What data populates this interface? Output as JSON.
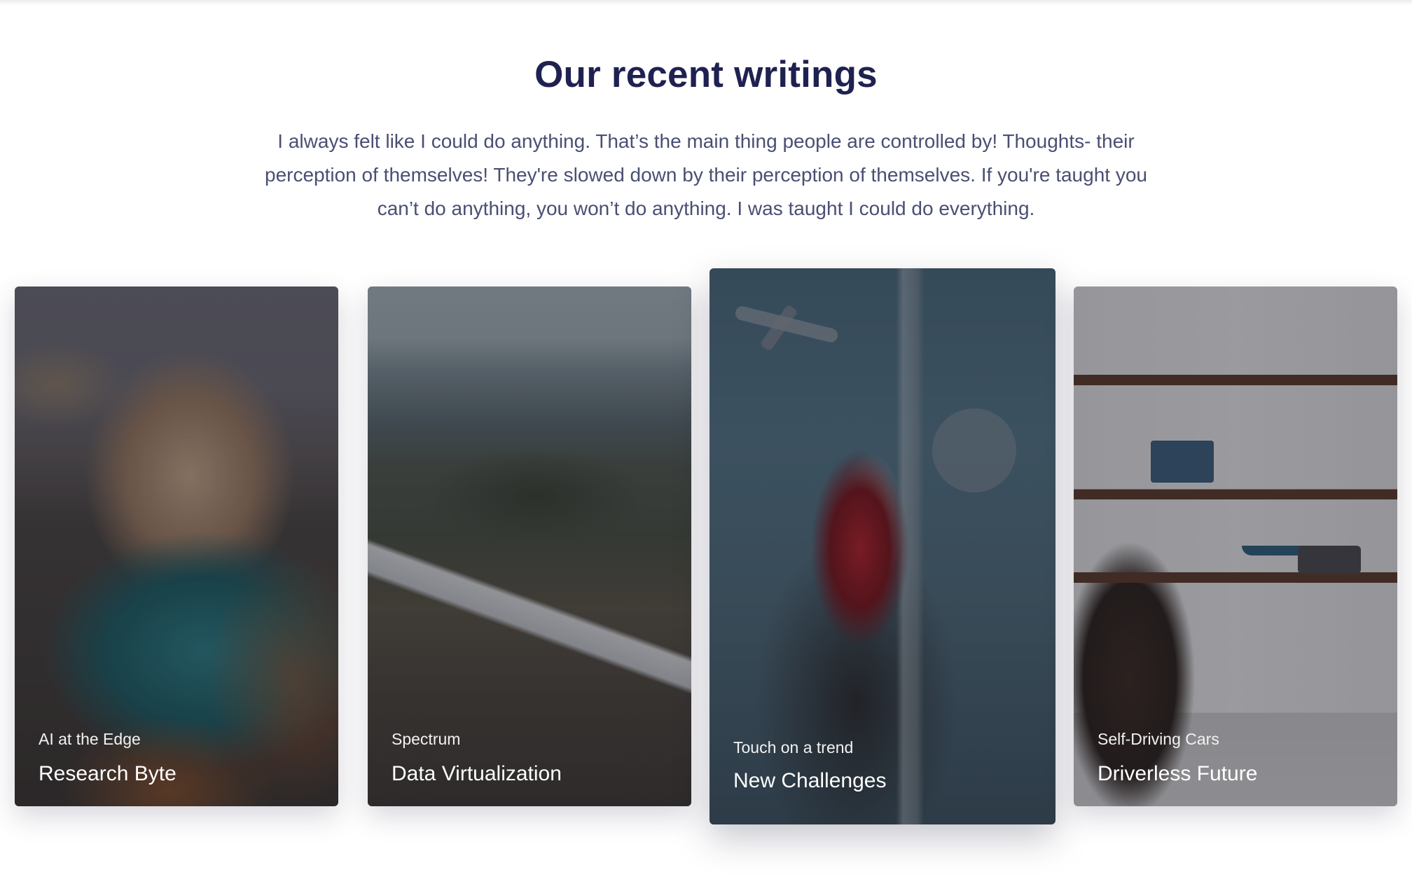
{
  "section": {
    "heading": "Our recent writings",
    "lead": "I always felt like I could do anything. That’s the main thing people are controlled by! Thoughts- their perception of themselves! They're slowed down by their perception of themselves. If you're taught you can’t do anything, you won’t do anything. I was taught I could do everything."
  },
  "cards": [
    {
      "category": "AI at the Edge",
      "title": "Research Byte",
      "image": "coastal-cliffs-photo"
    },
    {
      "category": "Spectrum",
      "title": "Data Virtualization",
      "image": "aerial-city-photo"
    },
    {
      "category": "Touch on a trend",
      "title": "New Challenges",
      "image": "sneaker-jump-photo"
    },
    {
      "category": "Self-Driving Cars",
      "title": "Driverless Future",
      "image": "kitchen-photo"
    }
  ]
}
